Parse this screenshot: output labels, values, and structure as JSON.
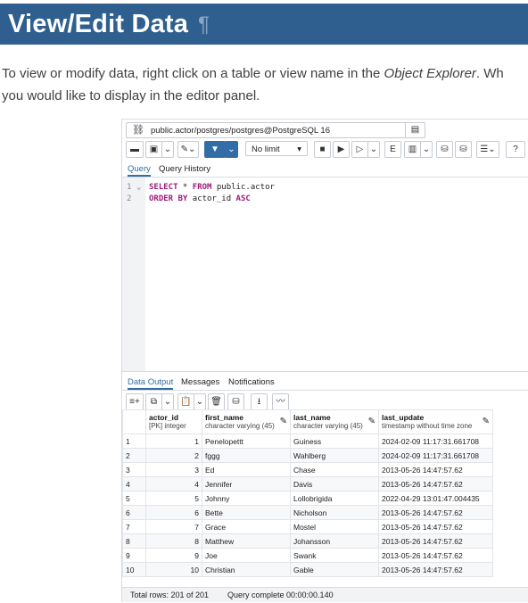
{
  "heading": {
    "title": "View/Edit Data",
    "pilcrow": "¶"
  },
  "intro": {
    "line1_pre": "To view or modify data, right click on a table or view name in the ",
    "line1_em": "Object Explorer",
    "line1_post": ". Wh",
    "line2": "you would like to display in the editor panel."
  },
  "connection": {
    "label": "public.actor/postgres/postgres@PostgreSQL 16"
  },
  "toolbar": {
    "limit": "No limit",
    "help": "?"
  },
  "tabs": [
    "Query",
    "Query History"
  ],
  "editor": {
    "line_numbers": [
      "1",
      "2"
    ],
    "line1": {
      "kw1": "SELECT",
      "mid": " * ",
      "kw2": "FROM",
      "rest": " public.actor"
    },
    "line2": {
      "kw1": "ORDER BY",
      "mid": " actor_id ",
      "kw2": "ASC"
    }
  },
  "output_tabs": [
    "Data Output",
    "Messages",
    "Notifications"
  ],
  "grid": {
    "columns": [
      {
        "name": "actor_id",
        "type": "[PK] integer"
      },
      {
        "name": "first_name",
        "type": "character varying (45)"
      },
      {
        "name": "last_name",
        "type": "character varying (45)"
      },
      {
        "name": "last_update",
        "type": "timestamp without time zone"
      }
    ],
    "rows": [
      {
        "n": "1",
        "id": "1",
        "first": "Penelopettt",
        "last": "Guiness",
        "ts": "2024-02-09 11:17:31.661708"
      },
      {
        "n": "2",
        "id": "2",
        "first": "fggg",
        "last": "Wahlberg",
        "ts": "2024-02-09 11:17:31.661708"
      },
      {
        "n": "3",
        "id": "3",
        "first": "Ed",
        "last": "Chase",
        "ts": "2013-05-26 14:47:57.62"
      },
      {
        "n": "4",
        "id": "4",
        "first": "Jennifer",
        "last": "Davis",
        "ts": "2013-05-26 14:47:57.62"
      },
      {
        "n": "5",
        "id": "5",
        "first": "Johnny",
        "last": "Lollobrigida",
        "ts": "2022-04-29 13:01:47.004435"
      },
      {
        "n": "6",
        "id": "6",
        "first": "Bette",
        "last": "Nicholson",
        "ts": "2013-05-26 14:47:57.62"
      },
      {
        "n": "7",
        "id": "7",
        "first": "Grace",
        "last": "Mostel",
        "ts": "2013-05-26 14:47:57.62"
      },
      {
        "n": "8",
        "id": "8",
        "first": "Matthew",
        "last": "Johansson",
        "ts": "2013-05-26 14:47:57.62"
      },
      {
        "n": "9",
        "id": "9",
        "first": "Joe",
        "last": "Swank",
        "ts": "2013-05-26 14:47:57.62"
      },
      {
        "n": "10",
        "id": "10",
        "first": "Christian",
        "last": "Gable",
        "ts": "2013-05-26 14:47:57.62"
      }
    ]
  },
  "status": {
    "total": "Total rows: 201 of 201",
    "query": "Query complete 00:00:00.140"
  },
  "colors": {
    "header_bg": "#2f5f8f",
    "accent": "#326da8",
    "keyword": "#9a1d7a"
  }
}
